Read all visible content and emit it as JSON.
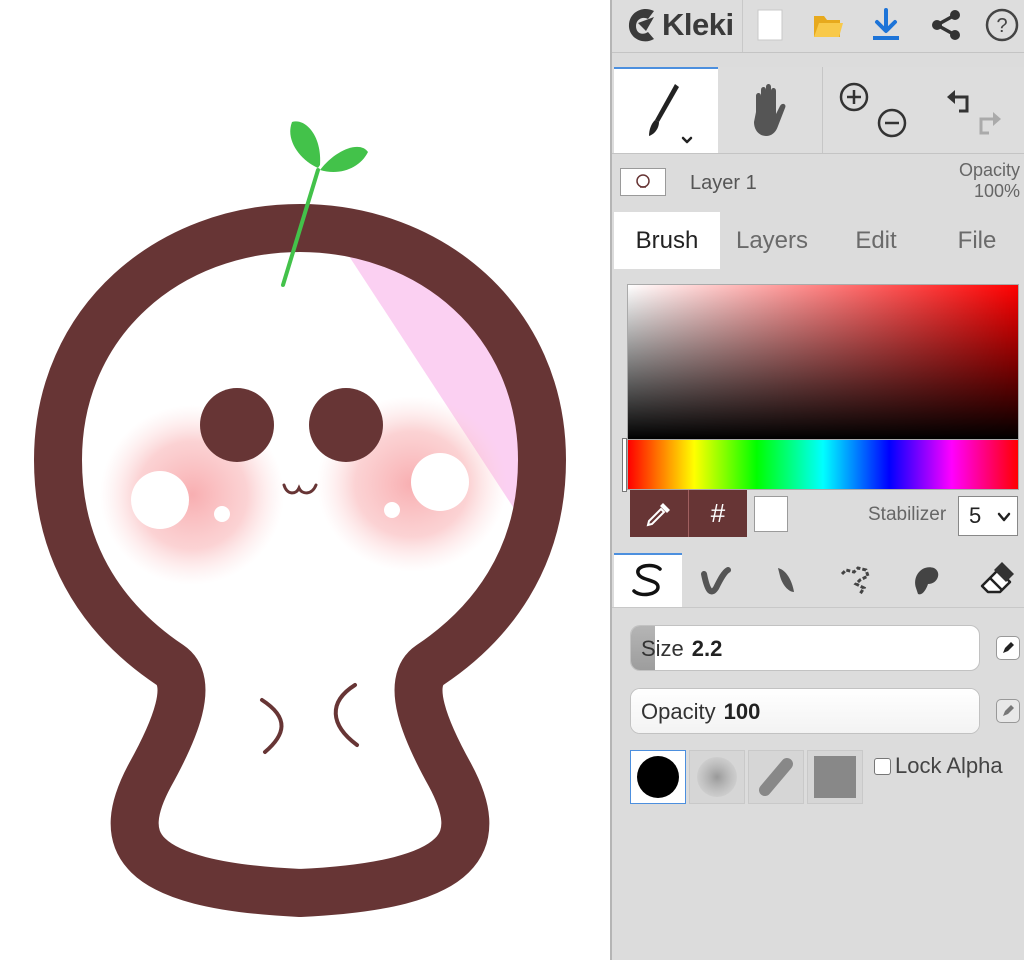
{
  "app": {
    "name": "Kleki"
  },
  "topbar": {
    "icons": [
      "kleki-logo-icon",
      "new-document-icon",
      "open-folder-icon",
      "download-icon",
      "share-icon",
      "help-icon"
    ]
  },
  "tools": {
    "active": "brush",
    "items": [
      "brush-tool",
      "hand-tool",
      "zoom-in",
      "zoom-out",
      "undo",
      "redo"
    ]
  },
  "layer": {
    "name": "Layer 1",
    "opacity_label": "Opacity",
    "opacity_value": "100%"
  },
  "tabs": [
    {
      "label": "Brush",
      "active": true
    },
    {
      "label": "Layers",
      "active": false
    },
    {
      "label": "Edit",
      "active": false
    },
    {
      "label": "File",
      "active": false
    }
  ],
  "color": {
    "primary": "#673535",
    "secondary": "#ffffff",
    "hex_symbol": "#"
  },
  "stabilizer": {
    "label": "Stabilizer",
    "value": "5"
  },
  "brush_types": [
    "pen-brush",
    "blend-brush",
    "sketchy-brush",
    "pixel-brush",
    "chemy-brush",
    "eraser"
  ],
  "brush": {
    "size_label": "Size",
    "size_value": "2.2",
    "size_fill_fraction": 0.07,
    "opacity_label": "Opacity",
    "opacity_value": "100",
    "opacity_fill_fraction": 1.0,
    "tips": [
      "round-hard",
      "round-soft",
      "chalk",
      "square"
    ],
    "active_tip": "round-hard",
    "lock_alpha_label": "Lock Alpha",
    "lock_alpha_checked": false
  },
  "drawing": {
    "colors": {
      "outline": "#673535",
      "sprout": "#43c24a",
      "blush": "#f7aeb0",
      "highlight": "#fbd0f2"
    }
  }
}
